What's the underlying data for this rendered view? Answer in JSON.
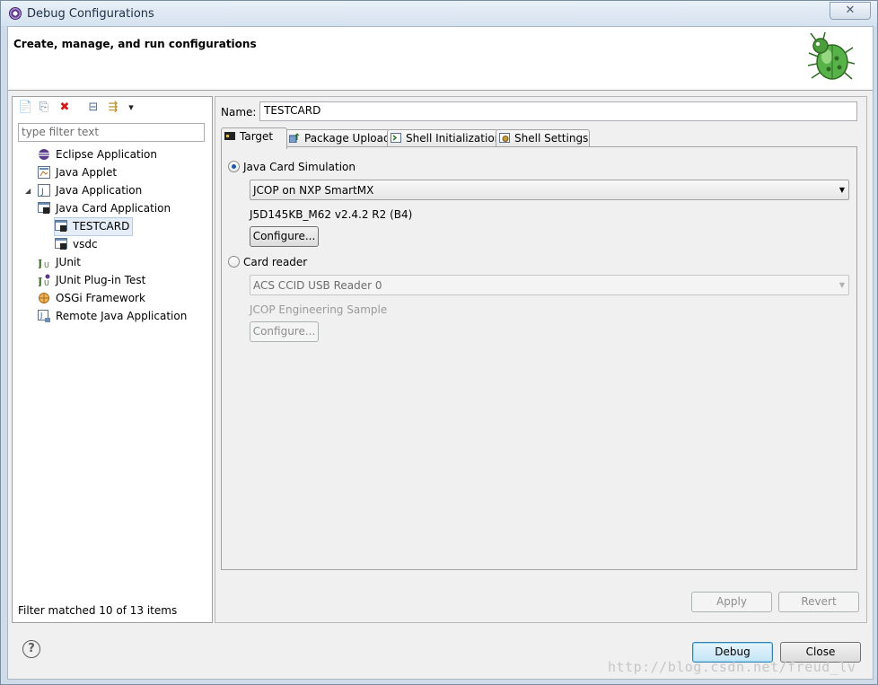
{
  "window": {
    "title": "Debug Configurations",
    "close_glyph": "✕"
  },
  "header": {
    "title": "Create, manage, and run configurations",
    "image": "bug-icon"
  },
  "left_panel": {
    "toolbar": [
      {
        "name": "new-launch-configuration-icon",
        "glyph": "📄"
      },
      {
        "name": "duplicate-icon",
        "glyph": "⎘"
      },
      {
        "name": "delete-icon",
        "glyph": "✖"
      },
      {
        "name": "collapse-all-icon",
        "glyph": "⊟"
      },
      {
        "name": "filter-icon",
        "glyph": "⇶"
      },
      {
        "name": "view-menu-icon",
        "glyph": "▾"
      }
    ],
    "filter_placeholder": "type filter text",
    "tree": [
      {
        "label": "Eclipse Application",
        "icon": "eclipse-icon"
      },
      {
        "label": "Java Applet",
        "icon": "java-applet-icon"
      },
      {
        "label": "Java Application",
        "icon": "java-application-icon"
      },
      {
        "label": "Java Card Application",
        "icon": "java-card-icon",
        "expanded": true
      },
      {
        "label": "TESTCARD",
        "icon": "java-card-config-icon",
        "selected": true
      },
      {
        "label": "vsdc",
        "icon": "java-card-config-icon"
      },
      {
        "label": "JUnit",
        "icon": "junit-icon"
      },
      {
        "label": "JUnit Plug-in Test",
        "icon": "junit-plugin-icon"
      },
      {
        "label": "OSGi Framework",
        "icon": "osgi-icon"
      },
      {
        "label": "Remote Java Application",
        "icon": "remote-java-icon"
      }
    ],
    "filter_status": "Filter matched 10 of 13 items"
  },
  "right_panel": {
    "name_label": "Name:",
    "name_value": "TESTCARD",
    "tabs": [
      {
        "label": "Target",
        "icon": "target-icon",
        "active": true
      },
      {
        "label": "Package Upload",
        "icon": "package-upload-icon"
      },
      {
        "label": "Shell Initialization",
        "icon": "shell-init-icon"
      },
      {
        "label": "Shell Settings",
        "icon": "shell-settings-icon"
      }
    ],
    "target": {
      "sim_radio": "Java Card Simulation",
      "sim_selected": true,
      "sim_combo": "JCOP on NXP SmartMX",
      "sim_info": "J5D145KB_M62 v2.4.2 R2 (B4)",
      "sim_configure": "Configure...",
      "reader_radio": "Card reader",
      "reader_combo": "ACS CCID USB Reader 0",
      "reader_info": "JCOP Engineering Sample",
      "reader_configure": "Configure..."
    },
    "apply": "Apply",
    "revert": "Revert"
  },
  "footer": {
    "debug": "Debug",
    "close": "Close",
    "help_glyph": "?"
  },
  "watermark": "http://blog.csdn.net/freud_lv"
}
